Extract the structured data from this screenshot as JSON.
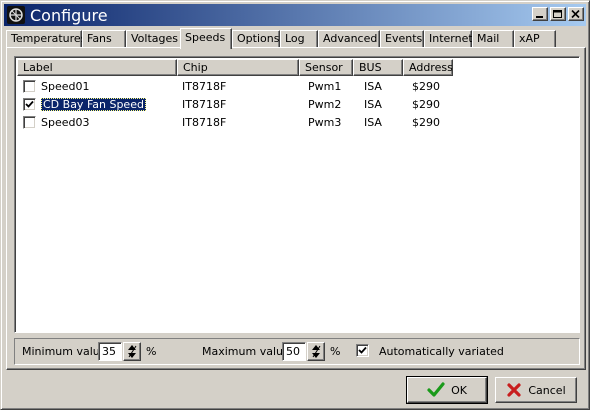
{
  "window": {
    "title": "Configure"
  },
  "tabs": [
    {
      "label": "Temperatures",
      "active": false
    },
    {
      "label": "Fans",
      "active": false
    },
    {
      "label": "Voltages",
      "active": false
    },
    {
      "label": "Speeds",
      "active": true
    },
    {
      "label": "Options",
      "active": false
    },
    {
      "label": "Log",
      "active": false
    },
    {
      "label": "Advanced",
      "active": false
    },
    {
      "label": "Events",
      "active": false
    },
    {
      "label": "Internet",
      "active": false
    },
    {
      "label": "Mail",
      "active": false
    },
    {
      "label": "xAP",
      "active": false
    }
  ],
  "list": {
    "columns": [
      "Label",
      "Chip",
      "Sensor",
      "BUS",
      "Address"
    ],
    "rows": [
      {
        "checked": false,
        "selected": false,
        "label": "Speed01",
        "chip": "IT8718F",
        "sensor": "Pwm1",
        "bus": "ISA",
        "address": "$290"
      },
      {
        "checked": true,
        "selected": true,
        "label": "CD Bay Fan Speed",
        "chip": "IT8718F",
        "sensor": "Pwm2",
        "bus": "ISA",
        "address": "$290"
      },
      {
        "checked": false,
        "selected": false,
        "label": "Speed03",
        "chip": "IT8718F",
        "sensor": "Pwm3",
        "bus": "ISA",
        "address": "$290"
      }
    ]
  },
  "controls": {
    "min_label": "Minimum value",
    "min_value": "35",
    "max_label": "Maximum value",
    "max_value": "50",
    "percent": "%",
    "auto_label": "Automatically variated",
    "auto_checked": true
  },
  "buttons": {
    "ok": "OK",
    "cancel": "Cancel"
  },
  "colors": {
    "selection": "#0a246a",
    "ok_check": "#1a9a1a",
    "cancel_x": "#c81e1e"
  }
}
